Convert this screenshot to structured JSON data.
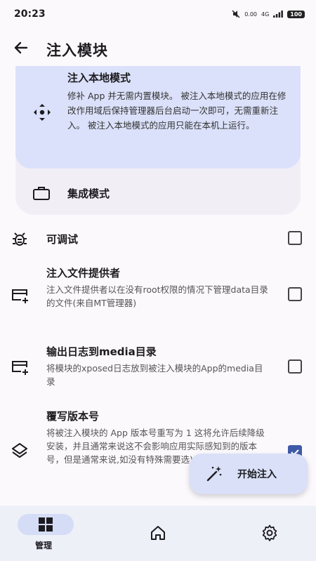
{
  "status_bar": {
    "time": "20:23",
    "net_speed": "0.00",
    "signal": "4G",
    "battery": "100"
  },
  "header": {
    "title": "注入模块"
  },
  "modes": {
    "local": {
      "title": "注入本地模式",
      "description": "修补 App 并无需内置模块。 被注入本地模式的应用在修改作用域后保持管理器后台启动一次即可，无需重新注入。 被注入本地模式的应用只能在本机上运行。"
    },
    "integrated": {
      "label": "集成模式"
    }
  },
  "settings": [
    {
      "title": "可调试",
      "description": "",
      "checked": false,
      "icon": "bug-icon"
    },
    {
      "title": "注入文件提供者",
      "description": "注入文件提供者以在没有root权限的情况下管理data目录的文件(来自MT管理器)",
      "checked": false,
      "icon": "card-plus-icon"
    },
    {
      "title": "输出日志到media目录",
      "description": "将模块的xposed日志放到被注入模块的App的media目录",
      "checked": false,
      "icon": "card-plus-icon"
    },
    {
      "title": "覆写版本号",
      "description": "将被注入模块的 App 版本号重写为 1 这将允许后续降级安装，并且通常来说这不会影响应用实际感知到的版本号，但是通常来说,如没有特殊需要选)",
      "checked": true,
      "icon": "layers-icon"
    }
  ],
  "fab": {
    "label": "开始注入"
  },
  "bottom_nav": [
    {
      "label": "管理",
      "icon": "grid-icon",
      "selected": true
    },
    {
      "label": "",
      "icon": "home-icon",
      "selected": false
    },
    {
      "label": "",
      "icon": "gear-icon",
      "selected": false
    }
  ],
  "colors": {
    "accent": "#3f5aa8",
    "card_selected": "#dbe1fa",
    "card": "#f1eef6",
    "nav_bg": "#eef0f8"
  }
}
